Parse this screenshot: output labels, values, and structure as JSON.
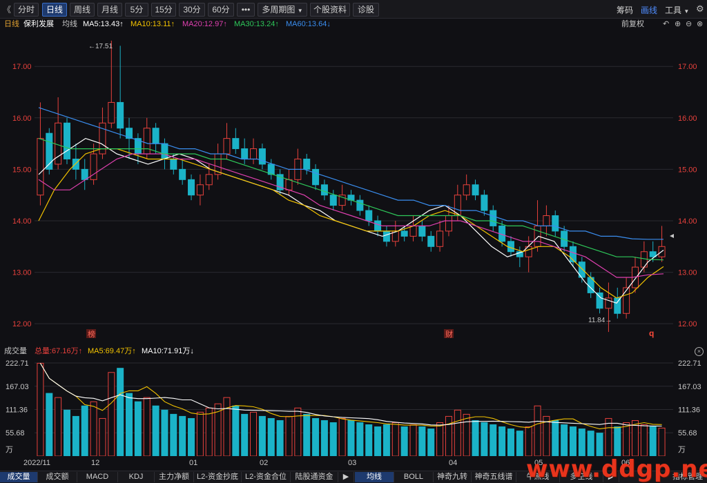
{
  "toolbar": {
    "back": "《",
    "periods": [
      "分时",
      "日线",
      "周线",
      "月线",
      "5分",
      "15分",
      "30分",
      "60分"
    ],
    "active_period": "日线",
    "more": "•••",
    "multi": "多周期图",
    "profile": "个股资料",
    "diagnose": "诊股",
    "chip": "筹码",
    "draw": "画线",
    "tools": "工具"
  },
  "info": {
    "period": "日线",
    "stock": "保利发展",
    "avg": "均线",
    "ma5": "MA5:13.43↑",
    "ma10": "MA10:13.11↑",
    "ma20": "MA20:12.97↑",
    "ma30": "MA30:13.24↑",
    "ma60": "MA60:13.64↓",
    "adjust": "前复权"
  },
  "price_axis": {
    "labels": [
      "17.00",
      "16.00",
      "15.00",
      "14.00",
      "13.00",
      "12.00"
    ],
    "ymin": 11.6,
    "ymax": 17.7
  },
  "annotations": {
    "high": "←17.51",
    "low": "11.84→",
    "mark1": "榜",
    "mark2": "财",
    "mark3": "q"
  },
  "volume": {
    "title": "成交量",
    "total": "总量:67.16万↑",
    "ma5": "MA5:69.47万↑",
    "ma10": "MA10:71.91万↓",
    "labels": [
      "222.71",
      "167.03",
      "111.36",
      "55.68"
    ],
    "unit": "万",
    "max": 222.71
  },
  "x_axis": {
    "labels": [
      "2022/11",
      "12",
      "01",
      "02",
      "03",
      "04",
      "05",
      "06"
    ]
  },
  "colors": {
    "up": "#e8413c",
    "down": "#1bb3c8",
    "ma5": "#ffffff",
    "ma10": "#f2c200",
    "ma20": "#e040b0",
    "ma30": "#2ec85a",
    "ma60": "#3a8ef0",
    "accent": "#4f8dff"
  },
  "chart_data": {
    "type": "candlestick",
    "candles": [
      [
        14.5,
        15.6,
        16.3,
        14.3,
        0
      ],
      [
        15.7,
        15.0,
        15.8,
        14.9,
        1
      ],
      [
        15.1,
        15.9,
        16.4,
        15.0,
        0
      ],
      [
        15.9,
        15.2,
        16.0,
        15.1,
        1
      ],
      [
        15.2,
        15.0,
        15.5,
        14.8,
        1
      ],
      [
        15.0,
        14.8,
        15.2,
        14.6,
        1
      ],
      [
        14.8,
        15.3,
        15.5,
        14.7,
        0
      ],
      [
        15.3,
        15.9,
        16.2,
        15.2,
        0
      ],
      [
        15.9,
        16.3,
        17.5,
        15.8,
        0
      ],
      [
        16.3,
        15.8,
        17.4,
        15.6,
        1
      ],
      [
        15.8,
        15.6,
        16.0,
        15.2,
        1
      ],
      [
        15.6,
        15.3,
        15.7,
        15.1,
        1
      ],
      [
        15.3,
        15.8,
        16.0,
        15.2,
        0
      ],
      [
        15.8,
        15.5,
        15.9,
        15.3,
        1
      ],
      [
        15.5,
        15.2,
        15.6,
        15.0,
        1
      ],
      [
        15.2,
        15.0,
        15.3,
        14.9,
        1
      ],
      [
        15.0,
        14.8,
        15.2,
        14.7,
        1
      ],
      [
        14.8,
        14.5,
        14.9,
        14.4,
        1
      ],
      [
        14.5,
        14.7,
        14.9,
        14.3,
        0
      ],
      [
        14.7,
        14.9,
        15.1,
        14.6,
        0
      ],
      [
        14.9,
        15.3,
        15.5,
        14.8,
        0
      ],
      [
        15.3,
        15.6,
        15.9,
        15.2,
        0
      ],
      [
        15.6,
        15.4,
        15.8,
        15.3,
        1
      ],
      [
        15.4,
        15.2,
        15.6,
        15.1,
        1
      ],
      [
        15.2,
        15.4,
        15.6,
        15.1,
        0
      ],
      [
        15.4,
        15.1,
        15.5,
        15.0,
        1
      ],
      [
        15.1,
        14.9,
        15.2,
        14.8,
        1
      ],
      [
        14.9,
        14.6,
        15.0,
        14.5,
        1
      ],
      [
        14.6,
        14.8,
        15.0,
        14.5,
        0
      ],
      [
        14.8,
        15.2,
        15.4,
        14.7,
        0
      ],
      [
        15.2,
        15.0,
        15.3,
        14.9,
        1
      ],
      [
        15.0,
        14.7,
        15.1,
        14.6,
        1
      ],
      [
        14.7,
        14.5,
        14.8,
        14.4,
        1
      ],
      [
        14.5,
        14.3,
        14.6,
        14.2,
        1
      ],
      [
        14.3,
        14.5,
        14.7,
        14.2,
        0
      ],
      [
        14.5,
        14.4,
        14.6,
        14.3,
        1
      ],
      [
        14.4,
        14.2,
        14.5,
        14.1,
        1
      ],
      [
        14.2,
        14.0,
        14.3,
        13.9,
        1
      ],
      [
        14.0,
        13.8,
        14.1,
        13.7,
        1
      ],
      [
        13.8,
        13.6,
        13.9,
        13.5,
        1
      ],
      [
        13.6,
        13.8,
        14.0,
        13.5,
        0
      ],
      [
        13.8,
        13.7,
        13.9,
        13.6,
        1
      ],
      [
        13.7,
        13.9,
        14.1,
        13.6,
        0
      ],
      [
        13.9,
        13.7,
        14.0,
        13.6,
        1
      ],
      [
        13.7,
        13.5,
        13.8,
        13.4,
        1
      ],
      [
        13.5,
        13.8,
        14.0,
        13.4,
        0
      ],
      [
        13.8,
        14.1,
        14.3,
        13.7,
        0
      ],
      [
        14.1,
        14.5,
        14.7,
        14.0,
        0
      ],
      [
        14.5,
        14.7,
        14.9,
        14.4,
        0
      ],
      [
        14.7,
        14.5,
        14.8,
        14.4,
        1
      ],
      [
        14.5,
        14.2,
        14.6,
        14.1,
        1
      ],
      [
        14.2,
        13.9,
        14.3,
        13.8,
        1
      ],
      [
        13.9,
        13.6,
        14.0,
        13.5,
        1
      ],
      [
        13.6,
        13.4,
        13.7,
        13.3,
        1
      ],
      [
        13.4,
        13.3,
        13.5,
        13.1,
        1
      ],
      [
        13.3,
        13.5,
        13.7,
        13.0,
        0
      ],
      [
        13.5,
        13.9,
        14.4,
        13.4,
        0
      ],
      [
        13.9,
        14.1,
        14.3,
        13.7,
        0
      ],
      [
        14.1,
        13.8,
        14.2,
        13.7,
        1
      ],
      [
        13.8,
        13.5,
        13.9,
        13.4,
        1
      ],
      [
        13.5,
        13.2,
        13.6,
        13.1,
        1
      ],
      [
        13.2,
        12.9,
        13.3,
        12.8,
        1
      ],
      [
        12.9,
        12.6,
        13.0,
        12.5,
        1
      ],
      [
        12.6,
        12.3,
        12.7,
        12.2,
        1
      ],
      [
        12.3,
        12.5,
        12.8,
        11.84,
        0
      ],
      [
        12.5,
        12.2,
        12.7,
        12.1,
        1
      ],
      [
        12.2,
        12.7,
        12.9,
        12.1,
        0
      ],
      [
        12.7,
        13.1,
        13.3,
        12.6,
        0
      ],
      [
        13.1,
        13.4,
        13.6,
        13.0,
        0
      ],
      [
        13.4,
        13.3,
        13.6,
        13.2,
        1
      ],
      [
        13.3,
        13.5,
        13.9,
        13.2,
        0
      ]
    ],
    "volumes": [
      222,
      150,
      140,
      110,
      95,
      120,
      130,
      90,
      200,
      210,
      150,
      130,
      140,
      120,
      110,
      100,
      95,
      90,
      105,
      115,
      125,
      140,
      120,
      100,
      105,
      95,
      90,
      85,
      95,
      115,
      100,
      90,
      85,
      80,
      90,
      85,
      80,
      75,
      70,
      75,
      80,
      70,
      75,
      70,
      65,
      80,
      95,
      110,
      100,
      85,
      80,
      75,
      70,
      65,
      60,
      70,
      120,
      95,
      85,
      75,
      70,
      65,
      60,
      55,
      90,
      70,
      80,
      85,
      75,
      70,
      67
    ],
    "series": [
      {
        "name": "MA5",
        "values": [
          14.9,
          15.2,
          15.4,
          15.6,
          15.5,
          15.3,
          15.2,
          15.1,
          15.2,
          15.3,
          15.2,
          15.0,
          14.9,
          14.8,
          14.7,
          14.6,
          14.5,
          14.3,
          14.2,
          14.0,
          13.9,
          13.8,
          13.7,
          13.8,
          14.0,
          14.2,
          14.3,
          14.1,
          13.8,
          13.5,
          13.3,
          13.4,
          13.7,
          13.6,
          13.2,
          12.8,
          12.5,
          12.4,
          12.8,
          13.2,
          13.43
        ]
      },
      {
        "name": "MA10",
        "values": [
          14.0,
          14.6,
          15.0,
          15.3,
          15.4,
          15.4,
          15.3,
          15.2,
          15.2,
          15.2,
          15.1,
          15.0,
          14.9,
          14.8,
          14.7,
          14.6,
          14.4,
          14.3,
          14.1,
          14.0,
          13.9,
          13.8,
          13.8,
          13.8,
          13.9,
          14.1,
          14.2,
          14.1,
          13.9,
          13.7,
          13.5,
          13.4,
          13.5,
          13.5,
          13.3,
          13.0,
          12.7,
          12.5,
          12.6,
          12.9,
          13.11
        ]
      },
      {
        "name": "MA20",
        "values": [
          14.8,
          14.6,
          14.6,
          14.8,
          15.0,
          15.2,
          15.3,
          15.3,
          15.3,
          15.2,
          15.2,
          15.1,
          15.0,
          14.9,
          14.8,
          14.7,
          14.6,
          14.5,
          14.3,
          14.2,
          14.1,
          14.0,
          13.9,
          13.9,
          13.9,
          13.9,
          14.0,
          14.0,
          13.9,
          13.8,
          13.7,
          13.6,
          13.6,
          13.5,
          13.4,
          13.3,
          13.1,
          12.9,
          12.9,
          12.95,
          12.97
        ]
      },
      {
        "name": "MA30",
        "values": [
          15.6,
          15.5,
          15.4,
          15.4,
          15.4,
          15.4,
          15.4,
          15.4,
          15.3,
          15.3,
          15.3,
          15.2,
          15.2,
          15.1,
          15.0,
          14.9,
          14.8,
          14.7,
          14.6,
          14.5,
          14.4,
          14.3,
          14.2,
          14.1,
          14.1,
          14.1,
          14.1,
          14.1,
          14.0,
          14.0,
          13.9,
          13.9,
          13.8,
          13.7,
          13.6,
          13.5,
          13.4,
          13.3,
          13.3,
          13.25,
          13.24
        ]
      },
      {
        "name": "MA60",
        "values": [
          16.2,
          16.1,
          16.0,
          15.9,
          15.8,
          15.7,
          15.6,
          15.5,
          15.5,
          15.4,
          15.4,
          15.3,
          15.3,
          15.2,
          15.2,
          15.1,
          15.0,
          15.0,
          14.9,
          14.8,
          14.7,
          14.6,
          14.5,
          14.4,
          14.4,
          14.3,
          14.3,
          14.2,
          14.2,
          14.1,
          14.0,
          14.0,
          13.9,
          13.9,
          13.8,
          13.8,
          13.7,
          13.7,
          13.65,
          13.64,
          13.64
        ]
      }
    ]
  }
}
